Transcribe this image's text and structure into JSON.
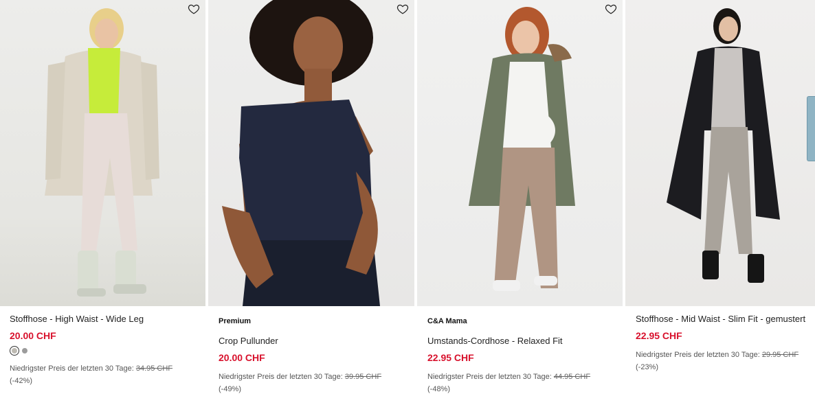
{
  "products": [
    {
      "brand": "",
      "title": "Stoffhose - High Waist - Wide Leg",
      "price": "20.00 CHF",
      "lowest_label": "Niedrigster Preis der letzten 30 Tage:",
      "lowest_price": "34.95 CHF",
      "discount": "(-42%)",
      "swatches": [
        "#bdbab2",
        "#9c9c9c"
      ]
    },
    {
      "brand": "Premium",
      "title": "Crop Pullunder",
      "price": "20.00 CHF",
      "lowest_label": "Niedrigster Preis der letzten 30 Tage:",
      "lowest_price": "39.95 CHF",
      "discount": "(-49%)"
    },
    {
      "brand": "C&A Mama",
      "title": "Umstands-Cordhose - Relaxed Fit",
      "price": "22.95 CHF",
      "lowest_label": "Niedrigster Preis der letzten 30 Tage:",
      "lowest_price": "44.95 CHF",
      "discount": "(-48%)"
    },
    {
      "brand": "",
      "title": "Stoffhose - Mid Waist - Slim Fit - gemustert",
      "price": "22.95 CHF",
      "lowest_label": "Niedrigster Preis der letzten 30 Tage:",
      "lowest_price": "29.95 CHF",
      "discount": "(-23%)"
    }
  ],
  "colors": {
    "price_red": "#d8112c",
    "text": "#222222",
    "muted": "#555555",
    "side_tab": "#8fb4c4"
  },
  "icons": {
    "favorite": "heart-outline-icon"
  }
}
